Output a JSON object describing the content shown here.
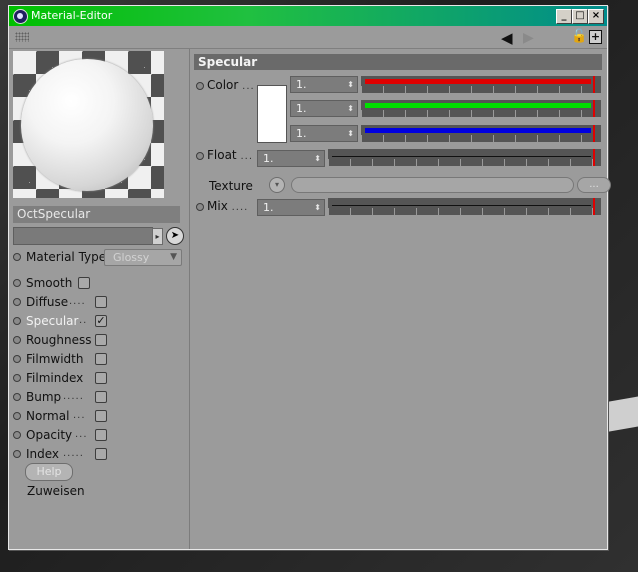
{
  "window": {
    "title": "Material-Editor",
    "controls": {
      "minimize": "_",
      "maximize": "□",
      "close": "×"
    }
  },
  "toolbar": {
    "back_icon": "arrow-left-icon",
    "forward_icon": "arrow-right-icon",
    "lock_icon": "lock-icon",
    "new_icon": "plus-icon"
  },
  "material": {
    "name": "OctSpecular",
    "type_label": "Material Type",
    "type_value": "Glossy"
  },
  "channels": [
    {
      "label": "Smooth",
      "checked": false
    },
    {
      "label": "Diffuse",
      "checked": false
    },
    {
      "label": "Specular",
      "checked": true
    },
    {
      "label": "Roughness",
      "checked": false
    },
    {
      "label": "Filmwidth",
      "checked": false
    },
    {
      "label": "Filmindex",
      "checked": false
    },
    {
      "label": "Bump",
      "checked": false
    },
    {
      "label": "Normal",
      "checked": false
    },
    {
      "label": "Opacity",
      "checked": false
    },
    {
      "label": "Index",
      "checked": false
    }
  ],
  "buttons": {
    "help": "Help",
    "assign": "Zuweisen",
    "texture_more": "..."
  },
  "section": {
    "title": "Specular",
    "color_label": "Color",
    "color_values": [
      "1.",
      "1.",
      "1."
    ],
    "float_label": "Float",
    "float_value": "1.",
    "texture_label": "Texture",
    "mix_label": "Mix",
    "mix_value": "1."
  },
  "colors": {
    "red": "#e00000",
    "green": "#00e000",
    "blue": "#0000e0",
    "swatch": "#ffffff"
  }
}
